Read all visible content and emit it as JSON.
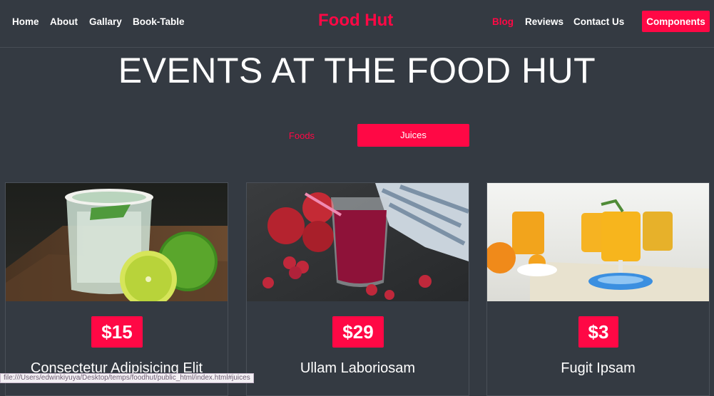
{
  "nav": {
    "links": [
      "Home",
      "About",
      "Gallary",
      "Book-Table"
    ],
    "brand": "Food Hut",
    "right_links": [
      "Blog",
      "Reviews",
      "Contact Us"
    ],
    "components_button": "Components"
  },
  "section": {
    "title": "EVENTS AT THE FOOD HUT",
    "tabs": [
      "Foods",
      "Juices"
    ],
    "active_tab": "Juices"
  },
  "cards": [
    {
      "price": "$15",
      "title": "Consectetur Adipisicing Elit",
      "image": "lime-margarita-photo"
    },
    {
      "price": "$29",
      "title": "Ullam Laboriosam",
      "image": "berry-smoothie-photo"
    },
    {
      "price": "$3",
      "title": "Fugit Ipsam",
      "image": "orange-cocktails-photo"
    }
  ],
  "status_bar": {
    "url": "file:///Users/edwinkiyuya/Desktop/temps/foodhut/public_html/index.html#juices"
  },
  "colors": {
    "background": "#343a42",
    "accent": "#ff0845",
    "text": "#ffffff"
  }
}
